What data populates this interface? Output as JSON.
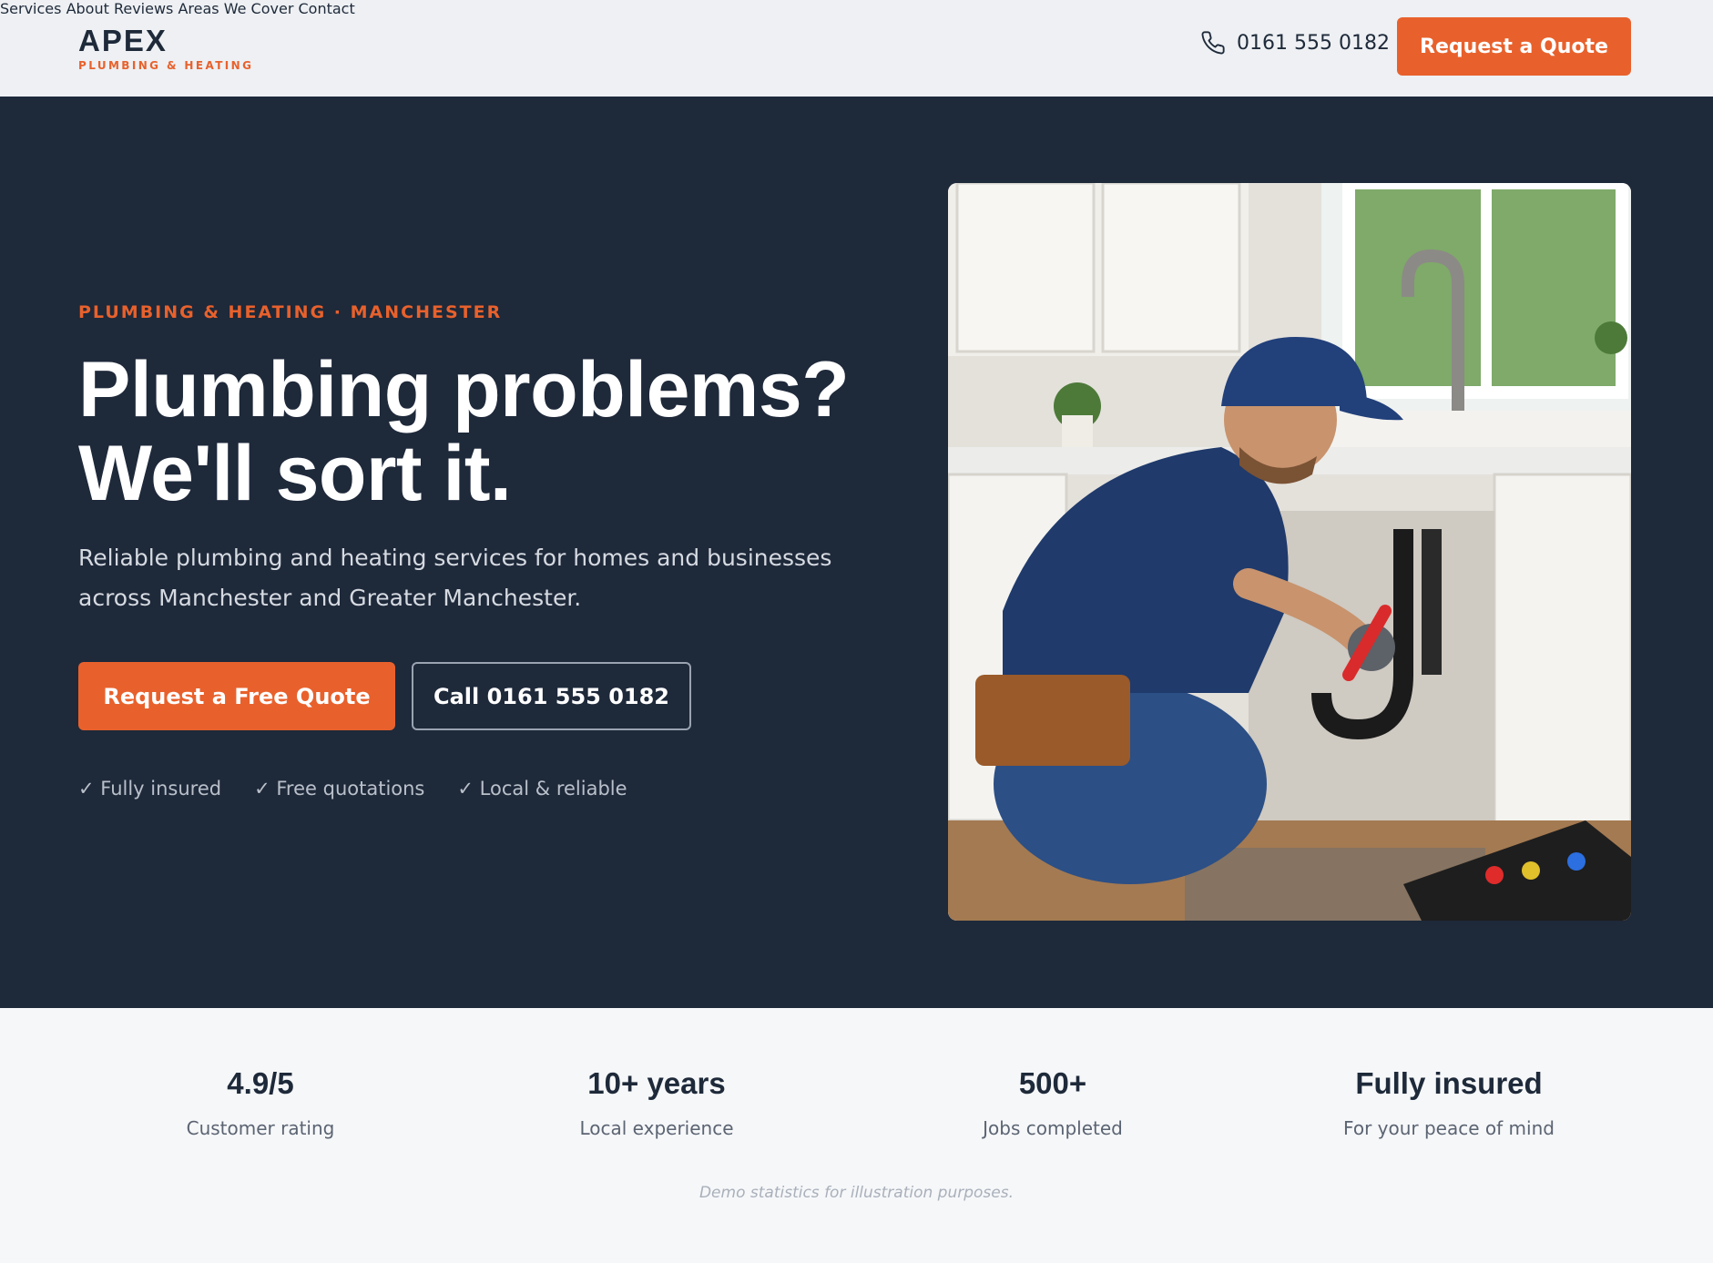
{
  "header": {
    "logo_name": "APEX",
    "logo_sub": "PLUMBING & HEATING",
    "nav": [
      "Services",
      "About",
      "Reviews",
      "Areas We Cover",
      "Contact"
    ],
    "phone": "0161 555 0182",
    "quote_button": "Request a Quote"
  },
  "hero": {
    "eyebrow": "PLUMBING & HEATING · MANCHESTER",
    "headline_line1": "Plumbing problems?",
    "headline_line2": "We'll sort it.",
    "subtext": "Reliable plumbing and heating services for homes and businesses across Manchester and Greater Manchester.",
    "primary_button": "Request a Free Quote",
    "secondary_button": "Call 0161 555 0182",
    "features": [
      "✓ Fully insured",
      "✓ Free quotations",
      "✓ Local & reliable"
    ]
  },
  "stats": [
    {
      "value": "4.9/5",
      "label": "Customer rating"
    },
    {
      "value": "10+ years",
      "label": "Local experience"
    },
    {
      "value": "500+",
      "label": "Jobs completed"
    },
    {
      "value": "Fully insured",
      "label": "For your peace of mind"
    }
  ],
  "disclaimer": "Demo statistics for illustration purposes.",
  "colors": {
    "accent": "#e8612c",
    "navy": "#1e293a",
    "header_bg": "#eef0f3",
    "stats_bg": "#f6f7f9"
  },
  "icons": {
    "phone": "phone-icon"
  }
}
